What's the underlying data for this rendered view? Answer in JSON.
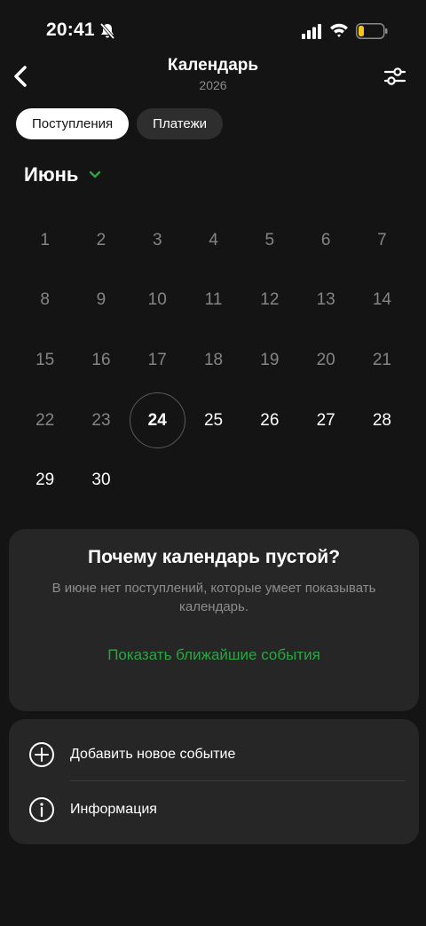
{
  "status_bar": {
    "time": "20:41",
    "icons": [
      "bell-slash-icon",
      "signal-icon",
      "wifi-icon",
      "battery-low-icon"
    ],
    "battery_color": "#f5c518"
  },
  "header": {
    "title": "Календарь",
    "subtitle": "2026",
    "back_icon": "chevron-left-icon",
    "filter_icon": "sliders-icon"
  },
  "tabs": [
    {
      "label": "Поступления",
      "active": true
    },
    {
      "label": "Платежи",
      "active": false
    }
  ],
  "month": {
    "label": "Июнь",
    "accent_color": "#2aa543"
  },
  "calendar": {
    "today": 24,
    "days": [
      1,
      2,
      3,
      4,
      5,
      6,
      7,
      8,
      9,
      10,
      11,
      12,
      13,
      14,
      15,
      16,
      17,
      18,
      19,
      20,
      21,
      22,
      23,
      24,
      25,
      26,
      27,
      28,
      29,
      30
    ]
  },
  "empty_card": {
    "title": "Почему календарь пустой?",
    "description": "В июне нет поступлений, которые умеет показывать календарь.",
    "link": "Показать ближайшие события",
    "link_color": "#2aa543"
  },
  "actions": {
    "add_event": "Добавить новое событие",
    "info": "Информация"
  }
}
